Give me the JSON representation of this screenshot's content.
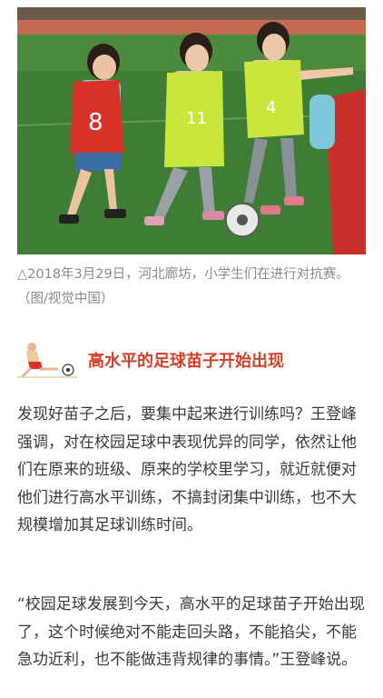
{
  "photo": {
    "alt_icon": "photo-girls-playing-soccer",
    "bib_numbers": [
      "8",
      "11",
      "4"
    ]
  },
  "caption": "△2018年3月29日，河北廊坊，小学生们在进行对抗赛。（图/视觉中国）",
  "section": {
    "icon": "soccer-player-icon",
    "title": "高水平的足球苗子开始出现",
    "title_color": "#d5402a"
  },
  "paragraphs": [
    "发现好苗子之后，要集中起来进行训练吗？王登峰强调，对在校园足球中表现优异的同学，依然让他们在原来的班级、原来的学校里学习，就近就便对他们进行高水平训练，不搞封闭集中训练，也不大规模增加其足球训练时间。",
    "“校园足球发展到今天，高水平的足球苗子开始出现了，这个时候绝对不能走回头路，不能掐尖，不能急功近利，也不能做违背规律的事情。”王登峰说。"
  ]
}
